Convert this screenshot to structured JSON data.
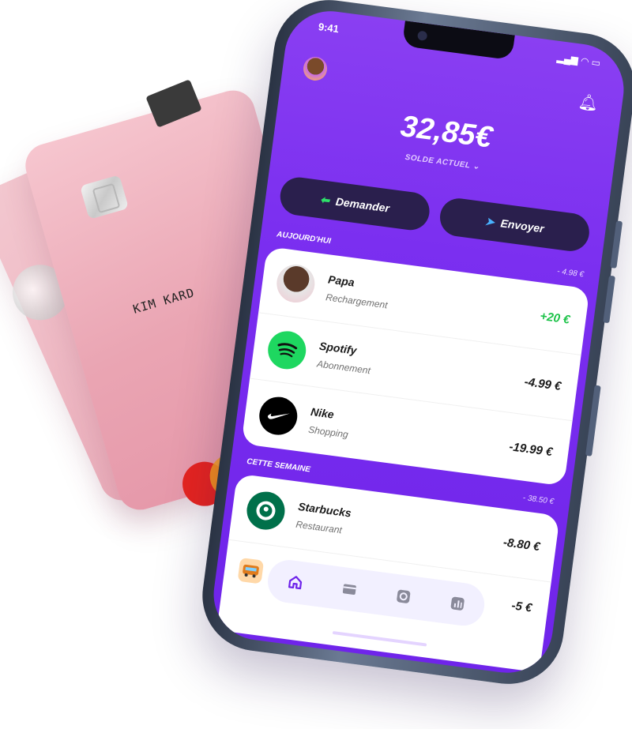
{
  "card": {
    "name": "KIM KARD",
    "brand": "mastercard"
  },
  "phone": {
    "status_time": "9:41",
    "status_icons": "▂▄▆ ◠ ▭",
    "balance": "32,85€",
    "balance_label": "SOLDE ACTUEL ⌄",
    "buttons": {
      "request": "Demander",
      "send": "Envoyer"
    },
    "sections": [
      {
        "title": "AUJOURD'HUI",
        "amount": "- 4.98 €"
      },
      {
        "title": "CETTE SEMAINE",
        "amount": "- 38.50 €"
      }
    ],
    "today": [
      {
        "name": "Papa",
        "sub": "Rechargement",
        "value": "+20 €",
        "icon": "avatar-photo"
      },
      {
        "name": "Spotify",
        "sub": "Abonnement",
        "value": "-4.99 €",
        "icon": "spotify-icon"
      },
      {
        "name": "Nike",
        "sub": "Shopping",
        "value": "-19.99 €",
        "icon": "nike-icon"
      }
    ],
    "week": [
      {
        "name": "Starbucks",
        "sub": "Restaurant",
        "value": "-8.80 €",
        "icon": "starbucks-icon"
      }
    ],
    "peek_value": "-5 €",
    "tabs": [
      "home-icon",
      "card-icon",
      "savings-icon",
      "stats-icon"
    ]
  },
  "colors": {
    "purple": "#7b2ff0",
    "dark_pill": "#2a1f4d",
    "positive": "#1ec34a",
    "card_pink": "#eaa5b3"
  }
}
